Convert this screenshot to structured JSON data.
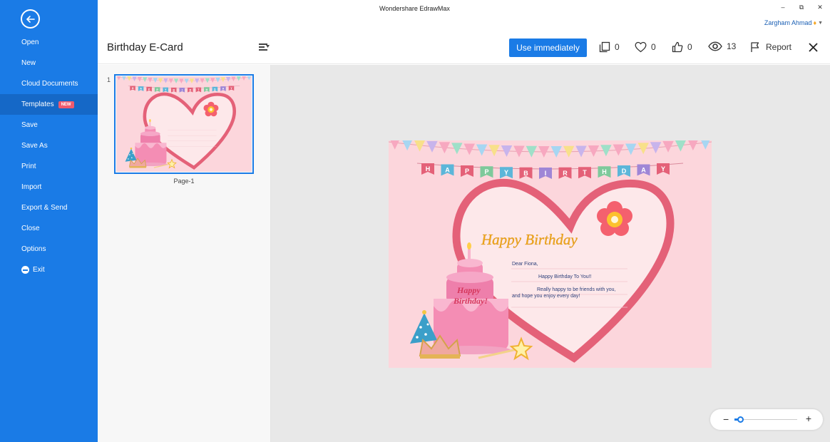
{
  "window": {
    "app_title": "Wondershare EdrawMax",
    "user_name": "Zargham Ahmad",
    "controls": {
      "minimize": "–",
      "restore": "⧉",
      "close": "✕"
    }
  },
  "sidebar": {
    "items": [
      {
        "label": "Open"
      },
      {
        "label": "New"
      },
      {
        "label": "Cloud Documents"
      },
      {
        "label": "Templates",
        "badge": "NEW",
        "active": true
      },
      {
        "label": "Save"
      },
      {
        "label": "Save As"
      },
      {
        "label": "Print"
      },
      {
        "label": "Import"
      },
      {
        "label": "Export & Send"
      },
      {
        "label": "Close"
      },
      {
        "label": "Options"
      },
      {
        "label": "Exit"
      }
    ]
  },
  "header": {
    "doc_title": "Birthday E-Card",
    "use_label": "Use immediately",
    "copies": "0",
    "favorites": "0",
    "likes": "0",
    "views": "13",
    "report_label": "Report"
  },
  "thumbnails": {
    "page_number": "1",
    "page_label": "Page-1"
  },
  "card": {
    "banner_letters": [
      "H",
      "A",
      "P",
      "P",
      "Y",
      "B",
      "I",
      "R",
      "T",
      "H",
      "D",
      "A",
      "Y"
    ],
    "headline": "Happy Birthday",
    "greeting": "Dear Fiona,",
    "line1": "Happy Birthday To You!!",
    "line2": "Really happy to be friends with you,",
    "line3": "and hope you enjoy every day!",
    "cake_line1": "Happy",
    "cake_line2": "Birthday!"
  },
  "zoom": {
    "minus_label": "−",
    "plus_label": "+",
    "level_fraction": 0.1
  },
  "colors": {
    "accent": "#1a7be6",
    "card_bg": "#fcd6dc",
    "heart": "#e85d75",
    "cake": "#f48db4"
  }
}
